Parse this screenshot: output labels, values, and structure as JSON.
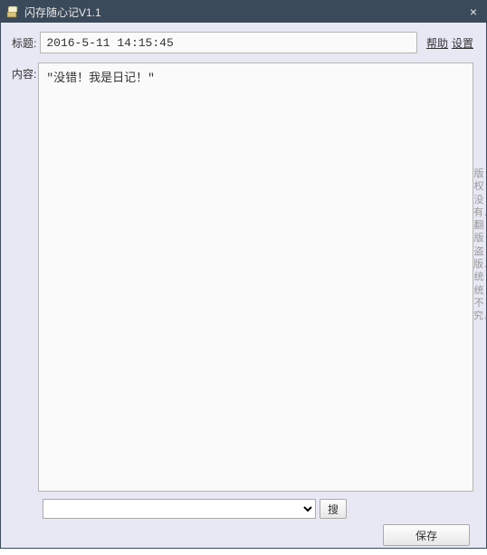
{
  "window": {
    "title": "闪存随心记V1.1",
    "close_label": "×"
  },
  "form": {
    "title_label": "标题:",
    "title_value": "2016-5-11 14:15:45",
    "body_label": "内容:",
    "body_value": "\"没错！我是日记！\""
  },
  "links": {
    "help": "帮助",
    "settings": "设置"
  },
  "footer": {
    "search_button": "搜",
    "save_button": "保存",
    "select_value": ""
  },
  "side_note": "版权没有．翻版盗版．统统不究．"
}
